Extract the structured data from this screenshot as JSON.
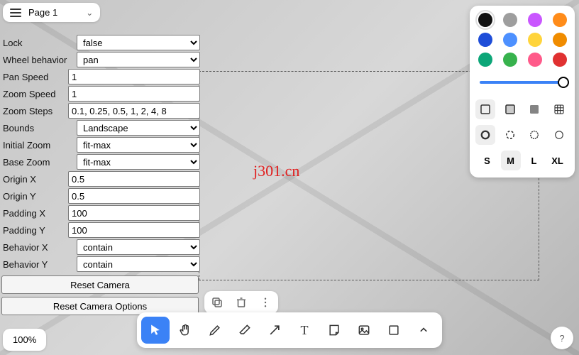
{
  "header": {
    "page_label": "Page 1"
  },
  "watermark": "j301.cn",
  "properties": {
    "rows": [
      {
        "label": "Lock",
        "type": "select",
        "value": "false"
      },
      {
        "label": "Wheel behavior",
        "type": "select",
        "value": "pan"
      },
      {
        "label": "Pan Speed",
        "type": "input",
        "value": "1"
      },
      {
        "label": "Zoom Speed",
        "type": "input",
        "value": "1"
      },
      {
        "label": "Zoom Steps",
        "type": "input",
        "value": "0.1, 0.25, 0.5, 1, 2, 4, 8"
      },
      {
        "label": "Bounds",
        "type": "select",
        "value": "Landscape"
      },
      {
        "label": "Initial Zoom",
        "type": "select",
        "value": "fit-max"
      },
      {
        "label": "Base Zoom",
        "type": "select",
        "value": "fit-max"
      },
      {
        "label": "Origin X",
        "type": "input",
        "value": "0.5"
      },
      {
        "label": "Origin Y",
        "type": "input",
        "value": "0.5"
      },
      {
        "label": "Padding X",
        "type": "input",
        "value": "100"
      },
      {
        "label": "Padding Y",
        "type": "input",
        "value": "100"
      },
      {
        "label": "Behavior X",
        "type": "select",
        "value": "contain"
      },
      {
        "label": "Behavior Y",
        "type": "select",
        "value": "contain"
      }
    ],
    "reset_camera": "Reset Camera",
    "reset_camera_options": "Reset Camera Options"
  },
  "style_panel": {
    "colors": [
      "#111111",
      "#9e9e9e",
      "#c956ff",
      "#ff8c1a",
      "#1e4dd8",
      "#4d90ff",
      "#ffd43b",
      "#f08c00",
      "#0ca678",
      "#37b24d",
      "#ff5a8a",
      "#e03131"
    ],
    "selected_color_index": 0,
    "opacity_value": 100,
    "fill_styles": [
      "none",
      "semi",
      "solid",
      "pattern"
    ],
    "selected_fill": 0,
    "dash_styles": [
      "solid-heavy",
      "dashed-circle",
      "dotted-circle",
      "outline-circle"
    ],
    "selected_dash": 0,
    "sizes": [
      "S",
      "M",
      "L",
      "XL"
    ],
    "selected_size": 1
  },
  "action_bar": {
    "items": [
      "duplicate",
      "trash",
      "more"
    ]
  },
  "toolbar": {
    "tools": [
      "select",
      "hand",
      "draw",
      "eraser",
      "arrow",
      "text",
      "note",
      "image",
      "shape",
      "more"
    ],
    "active_index": 0
  },
  "zoom": "100%",
  "help": "?"
}
